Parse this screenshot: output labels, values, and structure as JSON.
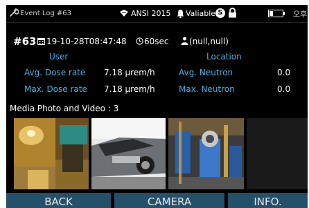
{
  "status_bar": {
    "title": "Event Log #63",
    "standard": "ANSI 2015",
    "mode": "Valiable",
    "s_badge": "S",
    "user_glyph": "오후"
  },
  "event": {
    "number": "#63",
    "datetime": "19-10-28T08:47:48",
    "duration": "60sec",
    "coordinates": "(null,null)"
  },
  "headers": {
    "user": "User",
    "location": "Location"
  },
  "rows": [
    {
      "label1": "Avg. Dose rate",
      "value1": "7.18 μrem/h",
      "label2": "Avg. Neutron",
      "value2": "0.0"
    },
    {
      "label1": "Max. Dose rate",
      "value1": "7.18 μrem/h",
      "label2": "Max. Neutron",
      "value2": "0.0"
    }
  ],
  "media": {
    "label": "Media Photo and Video : 3"
  },
  "buttons": {
    "back": "BACK",
    "camera": "CAMERA",
    "info": "INFO."
  },
  "colors": {
    "accent": "#3fb3e6",
    "button_bg": "#24506a",
    "background": "#000000"
  },
  "icons": [
    "wrench-icon",
    "shield-icon",
    "bell-icon",
    "lock-icon",
    "battery-icon",
    "calendar-icon",
    "clock-icon",
    "person-icon"
  ]
}
